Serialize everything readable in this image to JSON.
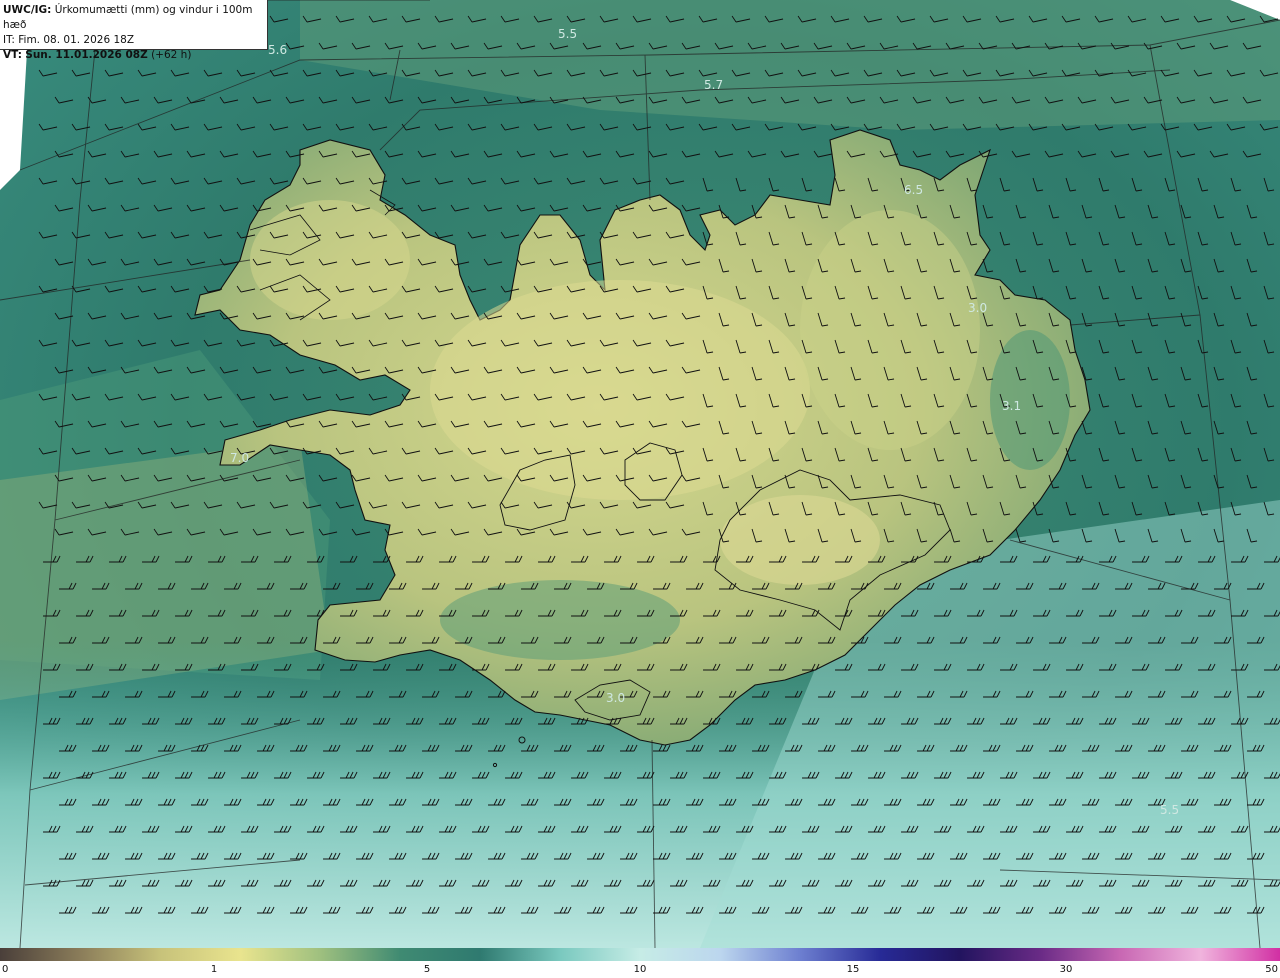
{
  "header": {
    "model_label": "UWC/IG:",
    "title": "Úrkomumætti (mm) og vindur i 100m hæð",
    "it_label": "IT:",
    "it_value": "Fim. 08. 01. 2026 18Z",
    "vt_label": "VT:",
    "vt_value": "Sun. 11.01.2026 08Z",
    "lead": "(+62 h)"
  },
  "colorbar": {
    "ticks": [
      "0",
      "1",
      "5",
      "10",
      "15",
      "30",
      "50"
    ],
    "colors": [
      "#4a3f3a",
      "#8b7d5a",
      "#c7c27a",
      "#e9e48e",
      "#9fc07f",
      "#3f8a72",
      "#2f7a70",
      "#7ac9bf",
      "#c6ece6",
      "#bcd6ee",
      "#6d7fd0",
      "#272a96",
      "#22145f",
      "#6a2b86",
      "#c867b3",
      "#f0b4dd",
      "#d12fa3"
    ]
  },
  "map": {
    "max_labels": [
      "5.6",
      "5.5",
      "5.7",
      "6.5",
      "3.0",
      "3.1",
      "7.0",
      "5.5",
      "3.0"
    ],
    "land_colors": [
      "#b8c27c",
      "#d6d88f"
    ],
    "sea_colors": [
      "#2f7a6c",
      "#7ccabf",
      "#b7e6df"
    ]
  }
}
